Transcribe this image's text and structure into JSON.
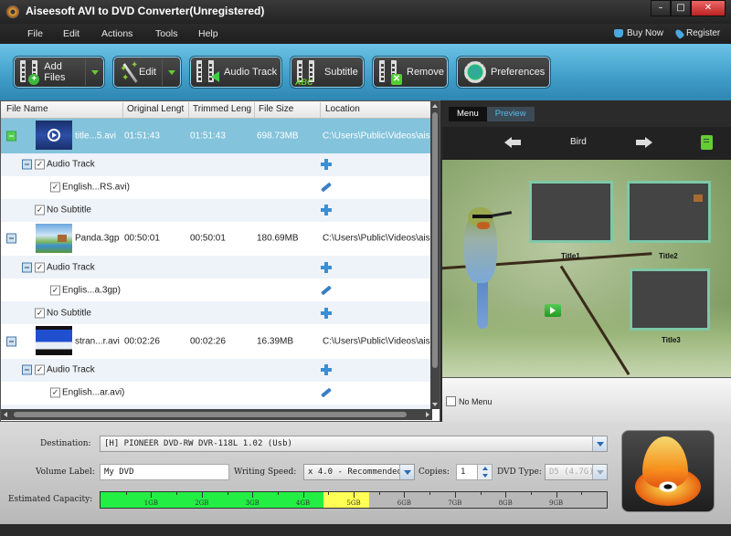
{
  "window": {
    "title": "Aiseesoft AVI to DVD Converter(Unregistered)",
    "controls": {
      "minimize": "–",
      "maximize": "□",
      "close": "✕"
    }
  },
  "menubar": {
    "items": [
      "File",
      "Edit",
      "Actions",
      "Tools",
      "Help"
    ],
    "right": [
      {
        "label": "Buy Now",
        "icon": "cart-icon"
      },
      {
        "label": "Register",
        "icon": "key-icon"
      }
    ]
  },
  "toolbar": {
    "buttons": [
      {
        "label": "Add Files",
        "icon": "add-files-icon",
        "dropdown": true
      },
      {
        "label": "Edit",
        "icon": "magic-wand-icon",
        "dropdown": true
      },
      {
        "label": "Audio Track",
        "icon": "audio-track-icon",
        "dropdown": false
      },
      {
        "label": "Subtitle",
        "icon": "subtitle-icon",
        "dropdown": false
      },
      {
        "label": "Remove",
        "icon": "remove-icon",
        "dropdown": false
      },
      {
        "label": "Preferences",
        "icon": "gear-icon",
        "dropdown": false
      }
    ]
  },
  "filelist": {
    "columns": [
      "File Name",
      "Original Lengt",
      "Trimmed Leng",
      "File Size",
      "Location"
    ],
    "files": [
      {
        "name": "title...5.avi",
        "original_length": "01:51:43",
        "trimmed_length": "01:51:43",
        "size": "698.73MB",
        "location": "C:\\Users\\Public\\Videos\\ais...",
        "selected": true,
        "audio_track_label": "Audio Track",
        "audio": "English...RS.avi)",
        "subtitle": "No Subtitle"
      },
      {
        "name": "Panda.3gp",
        "original_length": "00:50:01",
        "trimmed_length": "00:50:01",
        "size": "180.69MB",
        "location": "C:\\Users\\Public\\Videos\\ais...",
        "selected": false,
        "audio_track_label": "Audio Track",
        "audio": "Englis...a.3gp)",
        "subtitle": "No Subtitle"
      },
      {
        "name": "stran...r.avi",
        "original_length": "00:02:26",
        "trimmed_length": "00:02:26",
        "size": "16.39MB",
        "location": "C:\\Users\\Public\\Videos\\ais...",
        "selected": false,
        "audio_track_label": "Audio Track",
        "audio": "English...ar.avi)",
        "subtitle": ""
      }
    ]
  },
  "preview": {
    "tabs": [
      {
        "label": "Menu",
        "active": false
      },
      {
        "label": "Preview",
        "active": true
      }
    ],
    "template_name": "Bird",
    "chapters": [
      "Title1",
      "Title2",
      "Title3"
    ],
    "no_menu_label": "No Menu",
    "no_menu_checked": false
  },
  "settings": {
    "destination_label": "Destination:",
    "destination_value": "[H] PIONEER DVD-RW  DVR-118L 1.02 (Usb)",
    "volume_label_label": "Volume Label:",
    "volume_label_value": "My DVD",
    "writing_speed_label": "Writing Speed:",
    "writing_speed_value": "x 4.0 - Recommended",
    "copies_label": "Copies:",
    "copies_value": "1",
    "dvd_type_label": "DVD Type:",
    "dvd_type_value": "D5 (4.7G)",
    "capacity_label": "Estimated Capacity:"
  },
  "capacity": {
    "max_gb": 10,
    "used_gb": 4.4,
    "warning_gb": 5.3,
    "tick_labels": [
      "1GB",
      "2GB",
      "3GB",
      "4GB",
      "5GB",
      "6GB",
      "7GB",
      "8GB",
      "9GB"
    ],
    "colors": {
      "used": "#22ee44",
      "warning": "#ffff55",
      "empty": "#b8b8b8"
    }
  },
  "burn_button": {
    "icon": "burn-disc-icon"
  }
}
